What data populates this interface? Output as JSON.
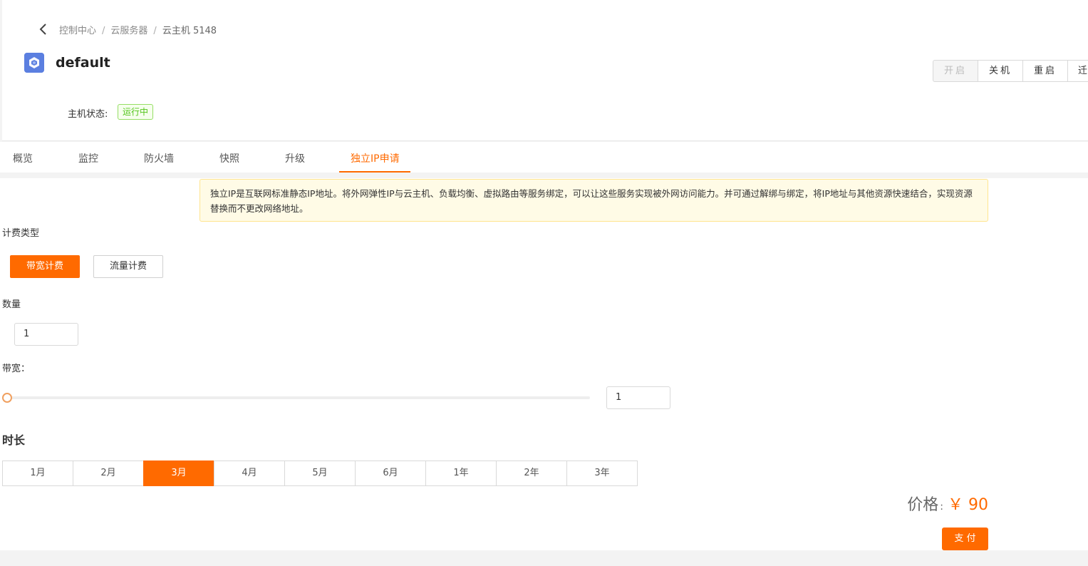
{
  "breadcrumb": {
    "items": [
      "控制中心",
      "云服务器",
      "云主机 5148"
    ]
  },
  "header": {
    "title": "default",
    "status_label": "主机状态:",
    "status_value": "运行中",
    "actions": [
      "开启",
      "关机",
      "重启",
      "迁"
    ]
  },
  "tabs": [
    "概览",
    "监控",
    "防火墙",
    "快照",
    "升级",
    "独立IP申请"
  ],
  "active_tab": "独立IP申请",
  "notice": "独立IP是互联网标准静态IP地址。将外网弹性IP与云主机、负载均衡、虚拟路由等服务绑定，可以让这些服务实现被外网访问能力。并可通过解绑与绑定，将IP地址与其他资源快速结合，实现资源替换而不更改网络地址。",
  "billing": {
    "label": "计费类型",
    "options": [
      "带宽计费",
      "流量计费"
    ],
    "selected": "带宽计费"
  },
  "quantity": {
    "label": "数量",
    "value": "1"
  },
  "bandwidth": {
    "label": "带宽：",
    "value": "1",
    "slider_fraction": 0
  },
  "duration": {
    "label": "时长",
    "options": [
      "1月",
      "2月",
      "3月",
      "4月",
      "5月",
      "6月",
      "1年",
      "2年",
      "3年"
    ],
    "selected": "3月"
  },
  "price": {
    "label": "价格",
    "colon": ":",
    "value": "￥ 90"
  },
  "pay_button": "支 付",
  "colors": {
    "accent": "#ff6a00",
    "success": "#52c41a"
  }
}
